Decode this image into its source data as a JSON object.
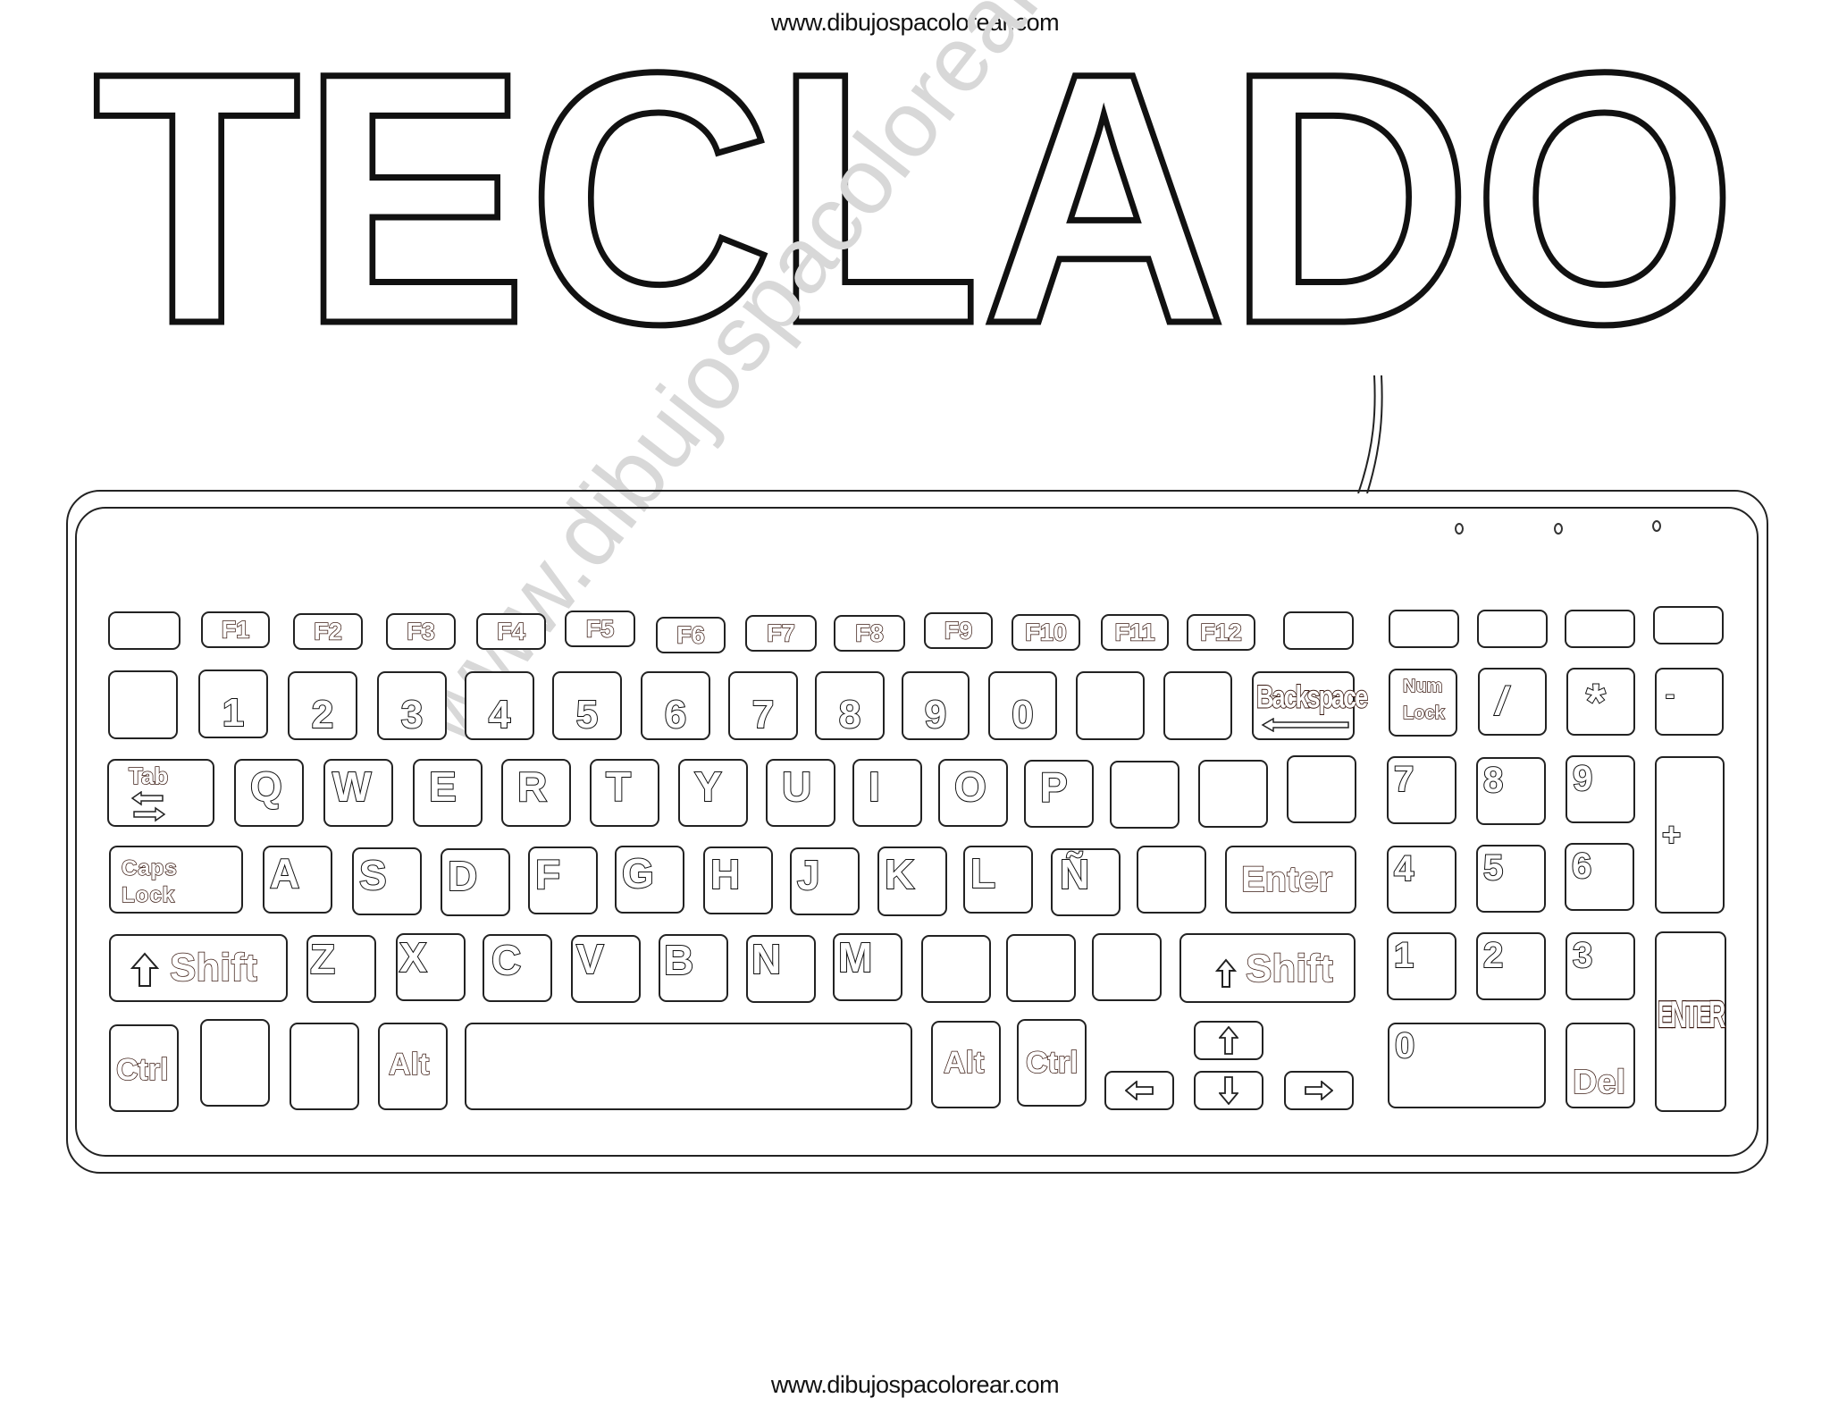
{
  "header": {
    "url": "www.dibujospacolorear.com"
  },
  "title": "TECLADO",
  "watermark": "www.dibujospacolorear.com",
  "footer": {
    "url": "www.dibujospacolorear.com"
  },
  "keyboard": {
    "function_row": [
      "",
      "F1",
      "F2",
      "F3",
      "F4",
      "F5",
      "F6",
      "F7",
      "F8",
      "F9",
      "F10",
      "F11",
      "F12",
      ""
    ],
    "number_row": [
      "",
      "1",
      "2",
      "3",
      "4",
      "5",
      "6",
      "7",
      "8",
      "9",
      "0",
      "",
      "",
      "Backspace"
    ],
    "qwerty_row": [
      "Tab",
      "Q",
      "W",
      "E",
      "R",
      "T",
      "Y",
      "U",
      "I",
      "O",
      "P",
      "",
      "",
      ""
    ],
    "home_row": [
      "Caps Lock",
      "A",
      "S",
      "D",
      "F",
      "G",
      "H",
      "J",
      "K",
      "L",
      "Ñ",
      "",
      "Enter"
    ],
    "shift_row": [
      "Shift",
      "Z",
      "X",
      "C",
      "V",
      "B",
      "N",
      "M",
      "",
      "",
      "",
      "Shift"
    ],
    "bottom_row": [
      "Ctrl",
      "",
      "",
      "Alt",
      "",
      "Alt",
      "Ctrl"
    ],
    "caps_line1": "Caps",
    "caps_line2": "Lock",
    "numlock_line1": "Num",
    "numlock_line2": "Lock",
    "numpad": {
      "top": [
        "",
        "",
        "",
        ""
      ],
      "row1": [
        "Num Lock",
        "/",
        "*",
        "-"
      ],
      "row2": [
        "7",
        "8",
        "9",
        "+"
      ],
      "row3": [
        "4",
        "5",
        "6"
      ],
      "row4": [
        "1",
        "2",
        "3",
        "ENTER"
      ],
      "row5": [
        "0",
        "Del"
      ]
    },
    "arrows": [
      "up-arrow",
      "left-arrow",
      "down-arrow",
      "right-arrow"
    ],
    "indicator_leds": 3
  }
}
